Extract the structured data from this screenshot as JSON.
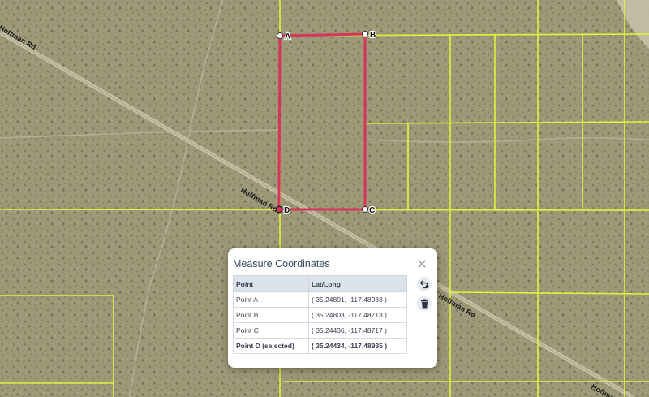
{
  "map": {
    "roads": [
      "Hoffman Rd",
      "Hoffman Rd",
      "Hoffman Rd",
      "Hoffman Rd"
    ],
    "points": [
      {
        "label": "A",
        "selected": false
      },
      {
        "label": "B",
        "selected": false
      },
      {
        "label": "C",
        "selected": false
      },
      {
        "label": "D",
        "selected": true
      }
    ],
    "colors": {
      "parcel_lines": "#e4f03c",
      "measure_polygon": "#d6345a",
      "terrain": "#9b9676"
    }
  },
  "panel": {
    "title": "Measure Coordinates",
    "columns": [
      "Point",
      "Lat/Long"
    ],
    "rows": [
      {
        "point": "Point A",
        "latlong": "( 35.24801, -117.48933 )"
      },
      {
        "point": "Point B",
        "latlong": "( 35.24803, -117.48713 )"
      },
      {
        "point": "Point C",
        "latlong": "( 35.24436, -117.48717 )"
      },
      {
        "point": "Point D (selected)",
        "latlong": "( 35.24434, -117.48935 )"
      }
    ],
    "icons": [
      "close-icon",
      "undo-icon",
      "trash-icon"
    ]
  }
}
